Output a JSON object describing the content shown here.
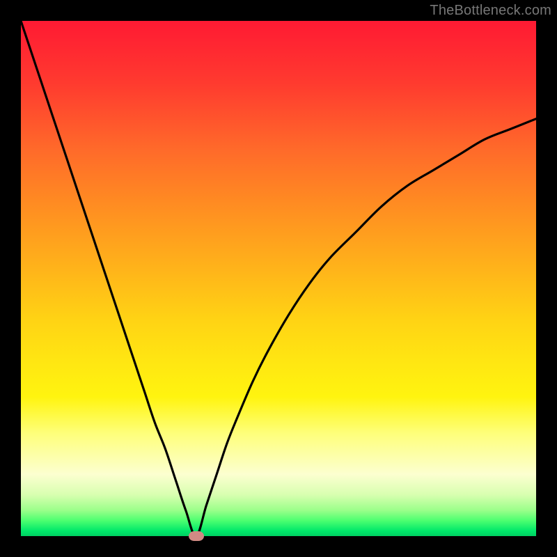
{
  "watermark": "TheBottleneck.com",
  "colors": {
    "frame": "#000000",
    "curve": "#000000",
    "marker": "#d08a84"
  },
  "chart_data": {
    "type": "line",
    "title": "",
    "xlabel": "",
    "ylabel": "",
    "xlim": [
      0,
      100
    ],
    "ylim": [
      0,
      100
    ],
    "grid": false,
    "legend": false,
    "note": "V-shaped bottleneck curve over a vertical red→green gradient. Minimum (near-zero bottleneck) occurs near x≈34. Values beyond x≈95 extend off the top of the plot.",
    "series": [
      {
        "name": "bottleneck-curve",
        "x": [
          0,
          2,
          4,
          6,
          8,
          10,
          12,
          14,
          16,
          18,
          20,
          22,
          24,
          26,
          28,
          30,
          32,
          34,
          36,
          38,
          40,
          42,
          45,
          48,
          52,
          56,
          60,
          65,
          70,
          75,
          80,
          85,
          90,
          95,
          100
        ],
        "values": [
          100,
          94,
          88,
          82,
          76,
          70,
          64,
          58,
          52,
          46,
          40,
          34,
          28,
          22,
          17,
          11,
          5,
          0,
          6,
          12,
          18,
          23,
          30,
          36,
          43,
          49,
          54,
          59,
          64,
          68,
          71,
          74,
          77,
          79,
          81
        ]
      }
    ],
    "marker": {
      "x": 34,
      "y": 0
    }
  }
}
